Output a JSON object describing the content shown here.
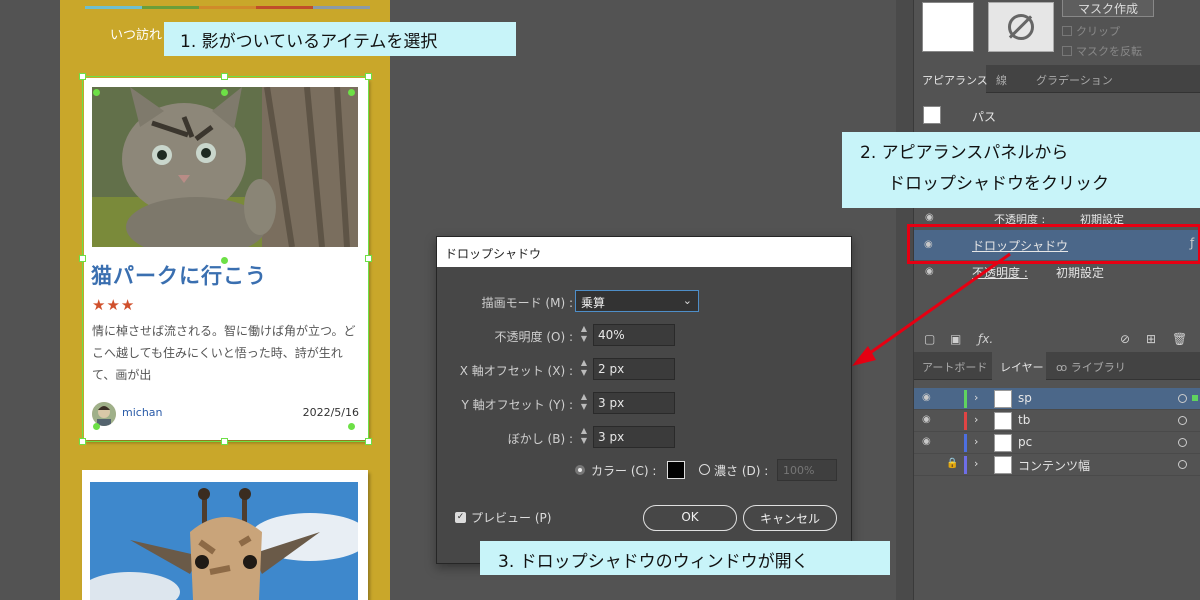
{
  "callouts": {
    "step1": "1. 影がついているアイテムを選択",
    "step2_line1": "2. アピアランスパネルから",
    "step2_line2": "ドロップシャドウをクリック",
    "step3": "3. ドロップシャドウのウィンドウが開く"
  },
  "artboard": {
    "header_text": "いつ訪れ"
  },
  "card": {
    "title": "猫パークに行こう",
    "stars": "★★★",
    "body": "情に棹させば流される。智に働けば角が立つ。どこへ越しても住みにくいと悟った時、詩が生れて、画が出",
    "author": "michan",
    "date": "2022/5/16"
  },
  "dialog": {
    "title": "ドロップシャドウ",
    "blend_mode_label": "描画モード (M) :",
    "blend_mode_value": "乗算",
    "opacity_label": "不透明度 (O) :",
    "opacity_value": "40%",
    "x_offset_label": "X 軸オフセット (X) :",
    "x_offset_value": "2 px",
    "y_offset_label": "Y 軸オフセット (Y) :",
    "y_offset_value": "3 px",
    "blur_label": "ぼかし (B) :",
    "blur_value": "3 px",
    "color_label": "カラー (C) :",
    "color_value": "#000000",
    "darkness_label": "濃さ (D) :",
    "darkness_value": "100%",
    "preview_label": "プレビュー (P)",
    "preview_checked": true,
    "ok_label": "OK",
    "cancel_label": "キャンセル"
  },
  "panel": {
    "mask_button": "マスク作成",
    "clip_label": "クリップ",
    "invert_mask_label": "マスクを反転",
    "appearance_tabs": [
      "アピアランス",
      "線",
      "グラデーション"
    ],
    "appearance_rows": {
      "path_label": "パス",
      "opacity_row1_label": "不透明度 :",
      "opacity_row1_value": "初期設定",
      "drop_shadow_label": "ドロップシャドウ",
      "opacity_row2_label": "不透明度 :",
      "opacity_row2_value": "初期設定"
    },
    "layer_tabs": [
      "アートボード",
      "レイヤー",
      "ライブラリ"
    ],
    "layers": [
      {
        "name": "sp",
        "color": "#5fd35f",
        "selected": true
      },
      {
        "name": "tb",
        "color": "#e04444",
        "selected": false
      },
      {
        "name": "pc",
        "color": "#4d6fe0",
        "selected": false
      },
      {
        "name": "コンテンツ幅",
        "color": "#6e6ee6",
        "selected": false,
        "locked": true
      }
    ]
  },
  "colors": {
    "artboard_bg": "#c9a72a",
    "selection": "#6de046",
    "callout_bg": "#c8f4f9",
    "highlight_red": "#e60012",
    "card_title": "#3a6fb0",
    "stars": "#d0502c"
  }
}
